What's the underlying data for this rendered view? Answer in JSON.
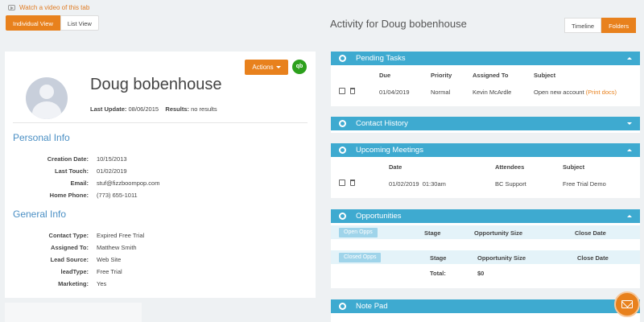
{
  "top": {
    "video_link": "Watch a video of this tab",
    "view_individual": "Individual View",
    "view_list": "List View"
  },
  "contact": {
    "actions_label": "Actions",
    "qb_badge": "qb",
    "name": "Doug bobenhouse",
    "last_update_label": "Last Update:",
    "last_update_value": "08/06/2015",
    "results_label": "Results:",
    "results_value": "no results"
  },
  "personal_info": {
    "title": "Personal Info",
    "rows": [
      {
        "label": "Creation Date:",
        "value": "10/15/2013"
      },
      {
        "label": "Last Touch:",
        "value": "01/02/2019"
      },
      {
        "label": "Email:",
        "value": "stuf@fizzboompop.com"
      },
      {
        "label": "Home Phone:",
        "value": "(773) 655-1011"
      }
    ]
  },
  "general_info": {
    "title": "General Info",
    "rows": [
      {
        "label": "Contact Type:",
        "value": "Expired Free Trial"
      },
      {
        "label": "Assigned To:",
        "value": "Matthew Smith"
      },
      {
        "label": "Lead Source:",
        "value": "Web Site"
      },
      {
        "label": "leadType:",
        "value": "Free Trial"
      },
      {
        "label": "Marketing:",
        "value": "Yes"
      }
    ]
  },
  "activity": {
    "title": "Activity for Doug bobenhouse",
    "tab_timeline": "Timeline",
    "tab_folders": "Folders"
  },
  "pending_tasks": {
    "title": "Pending Tasks",
    "headers": [
      "Due",
      "Priority",
      "Assigned To",
      "Subject"
    ],
    "row": {
      "due": "01/04/2019",
      "priority": "Normal",
      "assigned": "Kevin McArdle",
      "subject": "Open new account",
      "print": "(Print docs)"
    }
  },
  "contact_history": {
    "title": "Contact History"
  },
  "upcoming_meetings": {
    "title": "Upcoming Meetings",
    "headers": [
      "Date",
      "Attendees",
      "Subject"
    ],
    "row": {
      "date": "01/02/2019  01:30am",
      "attendees": "BC Support",
      "subject": "Free Trial Demo"
    }
  },
  "opportunities": {
    "title": "Opportunities",
    "open_badge": "Open Opps",
    "closed_badge": "Closed Opps",
    "open_headers": [
      "Stage",
      "Opportunity Size",
      "Close Date"
    ],
    "closed_headers": [
      "Stage",
      "Opportunity Size",
      "Close Date"
    ],
    "total_label": "Total:",
    "total_value": "$0"
  },
  "note_pad": {
    "title": "Note Pad"
  },
  "icons": {
    "video": "video-icon",
    "gear": "gear-icon",
    "edit": "edit-icon",
    "trash": "trash-icon",
    "mail": "mail-icon",
    "quickbooks": "quickbooks-icon"
  },
  "colors": {
    "accent": "#e8811d",
    "panel_header": "#3eaad0",
    "section_title": "#4a8fc4",
    "quickbooks": "#2ca01c"
  }
}
